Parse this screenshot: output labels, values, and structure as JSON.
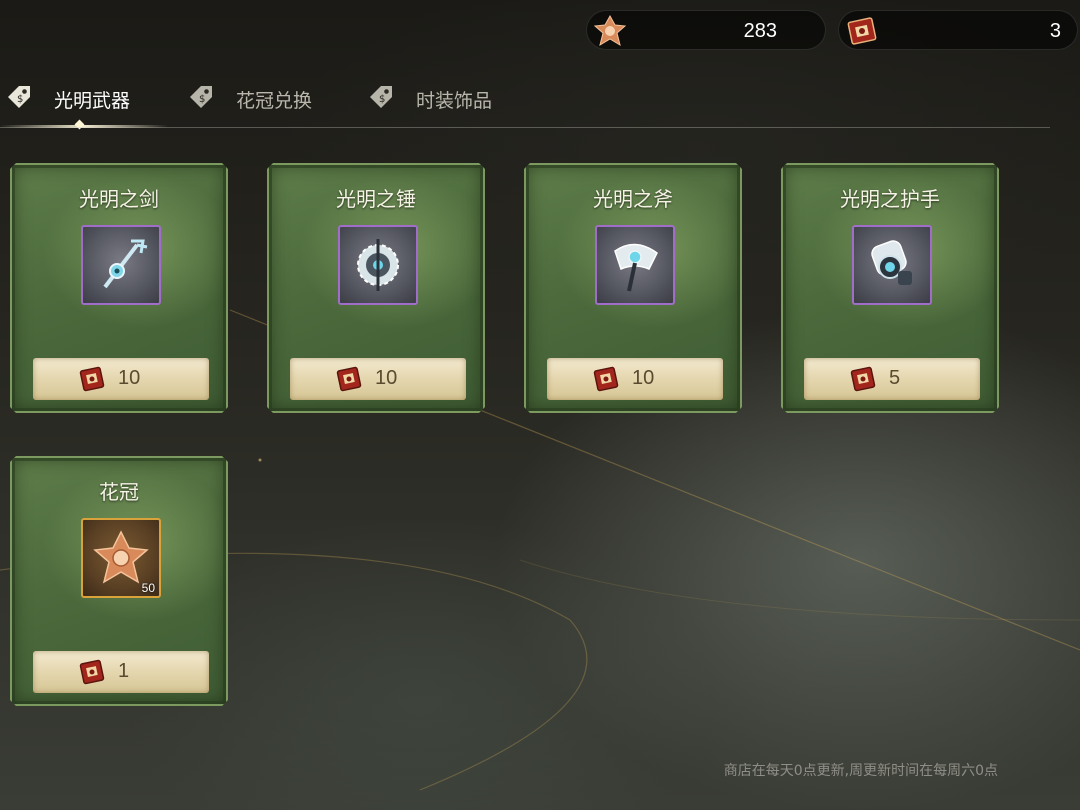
{
  "currencies": [
    {
      "name": "crown",
      "icon": "flower-crown-icon",
      "value": "283"
    },
    {
      "name": "token",
      "icon": "red-book-token-icon",
      "value": "3"
    }
  ],
  "tabs": [
    {
      "label": "光明武器",
      "icon": "price-tag-icon",
      "active": true
    },
    {
      "label": "花冠兑换",
      "icon": "price-tag-icon",
      "active": false
    },
    {
      "label": "时装饰品",
      "icon": "price-tag-icon",
      "active": false
    }
  ],
  "items": [
    {
      "name": "光明之剑",
      "icon": "trident-sword-icon",
      "rarity": "purple",
      "price": "10",
      "price_icon": "red-book-token-icon"
    },
    {
      "name": "光明之锤",
      "icon": "spiked-hammer-icon",
      "rarity": "purple",
      "price": "10",
      "price_icon": "red-book-token-icon"
    },
    {
      "name": "光明之斧",
      "icon": "axe-icon",
      "rarity": "purple",
      "price": "10",
      "price_icon": "red-book-token-icon"
    },
    {
      "name": "光明之护手",
      "icon": "gauntlet-icon",
      "rarity": "purple",
      "price": "5",
      "price_icon": "red-book-token-icon"
    },
    {
      "name": "花冠",
      "icon": "flower-crown-icon",
      "rarity": "gold",
      "quantity": "50",
      "price": "1",
      "price_icon": "red-book-token-icon"
    }
  ],
  "footer": {
    "note": "商店在每天0点更新,周更新时间在每周六0点"
  },
  "colors": {
    "card_green": "#4c6a3c",
    "purple_border": "#a06ec8",
    "gold_border": "#d9a23a",
    "price_bg": "#e4d6ae"
  }
}
